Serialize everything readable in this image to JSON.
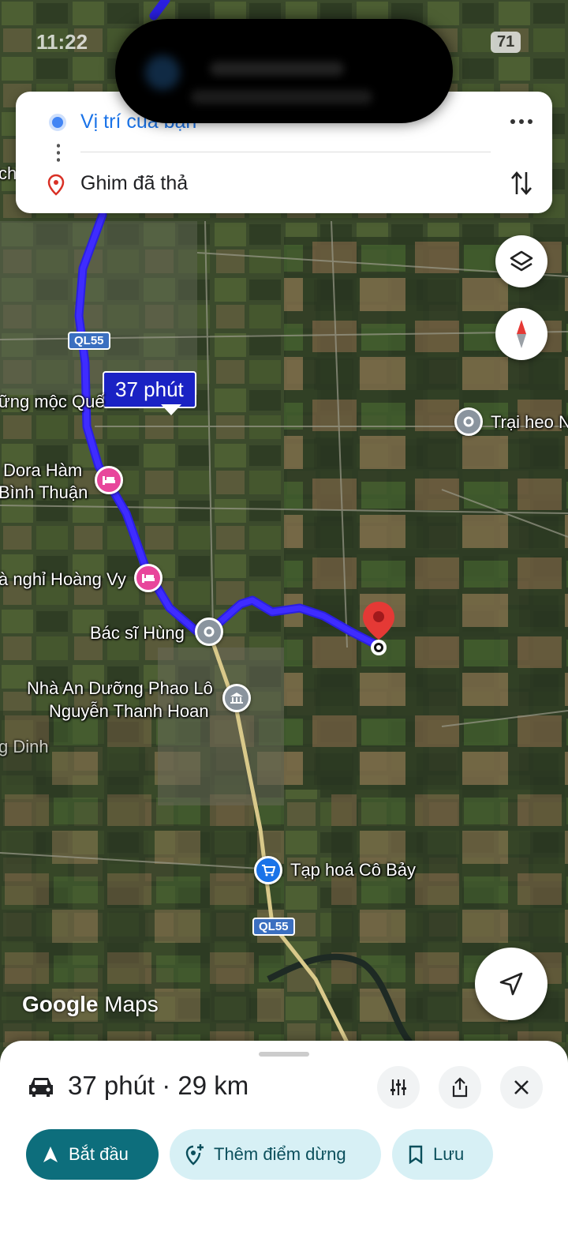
{
  "status_bar": {
    "time": "11:22",
    "badge": "71"
  },
  "route_card": {
    "origin": "Vị trí của bạn",
    "destination": "Ghim đã thả"
  },
  "map": {
    "eta_bubble": "37 phút",
    "road_shield_top": "QL55",
    "road_shield_bottom": "QL55",
    "labels": {
      "go_moc": "ững mộc Quế",
      "dora_1": "Dora Hàm",
      "dora_2": "Bình Thuận",
      "nha_nghi": "à nghỉ Hoàng Vy",
      "bac_si": "Bác sĩ Hùng",
      "nha_an_1": "Nhà An Dưỡng Phao Lô",
      "nha_an_2": "Nguyễn Thanh Hoan",
      "trai_heo": "Trại heo N",
      "tap_hoa": "Tạp hoá Cô Bảy",
      "edge_ch": "ch",
      "edge_dinh": "g Dinh"
    },
    "logo_google": "Google",
    "logo_maps": "Maps"
  },
  "bottom_sheet": {
    "summary": "37 phút · 29 km",
    "start_label": "Bắt đầu",
    "add_stop_label": "Thêm điểm dừng",
    "save_label": "Lưu"
  },
  "colors": {
    "route": "#2a1fe0",
    "accent": "#0d6e7c",
    "chip_bg": "#d7f0f5",
    "origin_blue": "#1a73e8",
    "pin_red": "#e53935"
  },
  "icons": {
    "origin": "blue-dot-icon",
    "destination": "pin-icon",
    "more": "more-horiz-icon",
    "swap": "swap-vert-icon",
    "layers": "layers-icon",
    "compass": "compass-icon",
    "locate": "navigation-arrow-icon",
    "car": "car-icon",
    "filter": "tune-icon",
    "share": "share-icon",
    "close": "close-icon",
    "hotel": "bed-icon",
    "shop": "cart-icon",
    "museum": "museum-icon"
  }
}
